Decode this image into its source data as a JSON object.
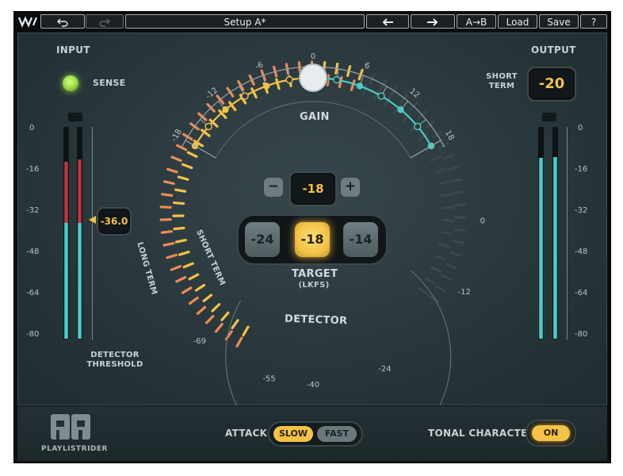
{
  "topbar": {
    "undo_icon": "undo-icon",
    "redo_icon": "redo-icon",
    "setup_name": "Setup A*",
    "prev_icon": "arrow-left-icon",
    "next_icon": "arrow-right-icon",
    "ab_label": "A→B",
    "load_label": "Load",
    "save_label": "Save",
    "help_label": "?"
  },
  "input": {
    "title": "INPUT",
    "sense_label": "SENSE",
    "scale": [
      "0",
      "-16",
      "-32",
      "-48",
      "-64",
      "-80"
    ],
    "meter_left": {
      "level_db": -36.0,
      "peak_db": -12.8
    },
    "meter_right": {
      "level_db": -36.0,
      "peak_db": -12.0
    },
    "threshold_value": "-36.0",
    "threshold_label_1": "DETECTOR",
    "threshold_label_2": "THRESHOLD"
  },
  "output": {
    "title": "OUTPUT",
    "short_term_label_1": "SHORT",
    "short_term_label_2": "TERM",
    "short_term_value": "-20",
    "scale": [
      "0",
      "-16",
      "-32",
      "-48",
      "-64",
      "-80"
    ],
    "meter_left": {
      "level_db": -11.5
    },
    "meter_right": {
      "level_db": -11.0
    }
  },
  "gain": {
    "label": "GAIN",
    "tick_labels": [
      "-18",
      "-12",
      "-6",
      "0",
      "6",
      "12",
      "18"
    ],
    "value_db": 0,
    "minus_label": "−",
    "plus_label": "+",
    "step_value": "-18"
  },
  "target": {
    "options": [
      "-24",
      "-18",
      "-14"
    ],
    "selected": "-18",
    "label": "TARGET",
    "unit": "(LKFS)"
  },
  "detector": {
    "label": "DETECTOR",
    "long_term_label": "LONG TERM",
    "short_term_label": "SHORT TERM",
    "tick_labels": [
      "-69",
      "-55",
      "-40",
      "-24",
      "-12",
      "0"
    ]
  },
  "footer": {
    "brand": "PLAYLISTRIDER",
    "attack_label": "ATTACK",
    "attack_slow": "SLOW",
    "attack_fast": "FAST",
    "attack_selected": "SLOW",
    "tonal_label": "TONAL CHARACTER",
    "tonal_value": "ON"
  },
  "colors": {
    "amber": "#f3c247",
    "teal": "#4fc9c4",
    "red": "#c8383f",
    "orange": "#f08a55",
    "sense_led": "#9ee04a"
  }
}
